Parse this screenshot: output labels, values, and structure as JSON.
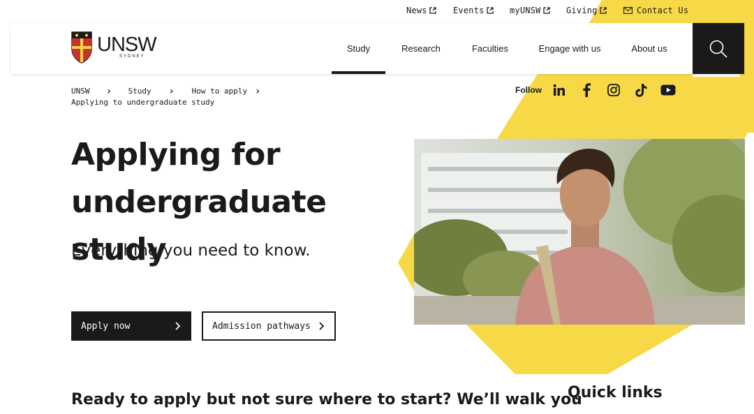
{
  "utility": {
    "links": [
      {
        "label": "News"
      },
      {
        "label": "Events"
      },
      {
        "label": "myUNSW"
      },
      {
        "label": "Giving"
      }
    ],
    "contact": "Contact Us"
  },
  "header": {
    "logo_text": "UNSW",
    "logo_sub": "SYDNEY",
    "nav": [
      "Study",
      "Research",
      "Faculties",
      "Engage with us",
      "About us"
    ],
    "active_nav": "Study"
  },
  "breadcrumb": {
    "items": [
      "UNSW",
      "Study",
      "How to apply"
    ],
    "current": "Applying to undergraduate study"
  },
  "follow": {
    "label": "Follow",
    "icons": [
      "linkedin-icon",
      "facebook-icon",
      "instagram-icon",
      "tiktok-icon",
      "youtube-icon"
    ]
  },
  "hero": {
    "title_line1": "Applying for",
    "title_line2": "undergraduate study",
    "subtitle": "Everything you need to know.",
    "primary_button": "Apply now",
    "secondary_button": "Admission pathways"
  },
  "content": {
    "heading": "Ready to apply but not sure where to start? We’ll walk you",
    "quick_links": "Quick links"
  },
  "colors": {
    "accent_yellow": "#f7d947",
    "dark": "#1a1a1a"
  }
}
